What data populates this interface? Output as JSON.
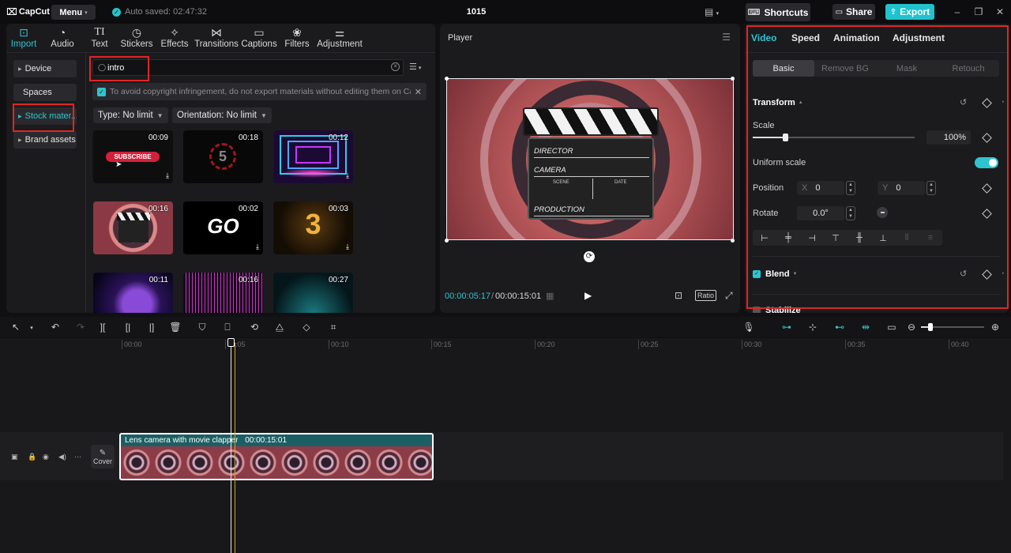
{
  "titlebar": {
    "logo": "CapCut",
    "menu_label": "Menu",
    "autosave": "Auto saved: 02:47:32",
    "project_title": "1015",
    "shortcuts_label": "Shortcuts",
    "share_label": "Share",
    "export_label": "Export"
  },
  "media": {
    "tabs": [
      {
        "label": "Import",
        "icon": "import-icon"
      },
      {
        "label": "Audio",
        "icon": "audio-icon"
      },
      {
        "label": "Text",
        "icon": "text-icon"
      },
      {
        "label": "Stickers",
        "icon": "stickers-icon"
      },
      {
        "label": "Effects",
        "icon": "effects-icon"
      },
      {
        "label": "Transitions",
        "icon": "transitions-icon"
      },
      {
        "label": "Captions",
        "icon": "captions-icon"
      },
      {
        "label": "Filters",
        "icon": "filters-icon"
      },
      {
        "label": "Adjustment",
        "icon": "adjustment-icon"
      }
    ],
    "sidebar": [
      "Device",
      "Spaces",
      "Stock mater...",
      "Brand assets"
    ],
    "search_value": "intro",
    "notice": "To avoid copyright infringement, do not export materials without editing them on Ca",
    "filter_type": "Type: No limit",
    "filter_orientation": "Orientation: No limit",
    "thumbnails": [
      {
        "duration": "00:09",
        "label": "SUBSCRIBE"
      },
      {
        "duration": "00:18",
        "label": "5"
      },
      {
        "duration": "00:12",
        "label": ""
      },
      {
        "duration": "00:16",
        "label": ""
      },
      {
        "duration": "00:02",
        "label": "GO"
      },
      {
        "duration": "00:03",
        "label": "3"
      },
      {
        "duration": "00:11",
        "label": ""
      },
      {
        "duration": "00:16",
        "label": ""
      },
      {
        "duration": "00:27",
        "label": ""
      }
    ]
  },
  "player": {
    "title": "Player",
    "clapper_lines": [
      "DIRECTOR",
      "CAMERA",
      "PRODUCTION"
    ],
    "clapper_small": [
      "SCENE",
      "DATE"
    ],
    "current_time": "00:00:05:17",
    "total_time": "00:00:15:01",
    "ratio_label": "Ratio"
  },
  "props": {
    "tabs": [
      "Video",
      "Speed",
      "Animation",
      "Adjustment"
    ],
    "segments": [
      "Basic",
      "Remove BG",
      "Mask",
      "Retouch"
    ],
    "transform_label": "Transform",
    "scale_label": "Scale",
    "scale_value": "100%",
    "scale_fraction": 0.2,
    "uniform_label": "Uniform scale",
    "position_label": "Position",
    "pos_x_label": "X",
    "pos_x": "0",
    "pos_y_label": "Y",
    "pos_y": "0",
    "rotate_label": "Rotate",
    "rotate_value": "0.0°",
    "blend_label": "Blend",
    "stabilize_label": "Stabilize"
  },
  "timeline": {
    "ruler": [
      "00:00",
      "00:05",
      "00:10",
      "00:15",
      "00:20",
      "00:25",
      "00:30",
      "00:35",
      "00:40"
    ],
    "clip_title": "Lens camera with movie clapper",
    "clip_duration": "00:00:15:01",
    "cover_label": "Cover",
    "zoom_fraction": 0.15
  },
  "colors": {
    "accent": "#2ec4cf",
    "highlight": "#e02525"
  }
}
